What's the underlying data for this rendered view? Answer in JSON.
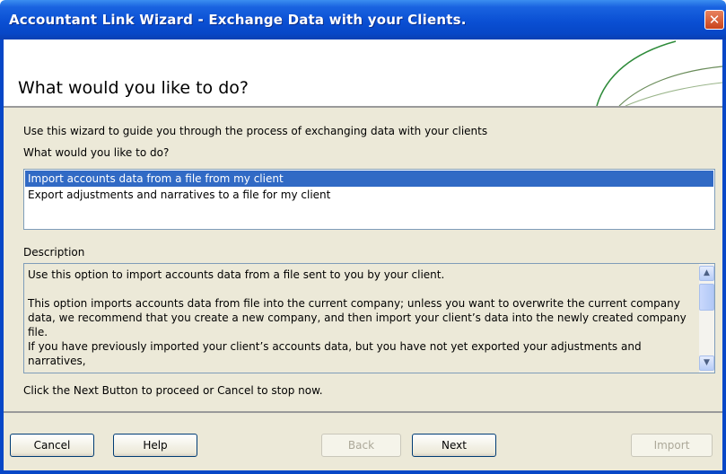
{
  "window": {
    "title": "Accountant Link Wizard - Exchange Data with your Clients.",
    "close_label": "✕"
  },
  "header": {
    "page_title": "What would you like to do?"
  },
  "main": {
    "intro_text": "Use this wizard to guide you through the process of exchanging data with your clients",
    "question": "What would you like to do?",
    "options": [
      {
        "label": "Import accounts data from a file from my client",
        "selected": true
      },
      {
        "label": "Export adjustments and narratives to a file for my client",
        "selected": false
      }
    ],
    "description_label": "Description",
    "description_paragraphs": [
      "Use this option to import accounts data from a file sent to you by your client.",
      "This option imports accounts data from file into the current company; unless you want to overwrite the current company data, we recommend that you create a new company, and then import your client’s data into the newly created company file.",
      "If you have previously imported your client’s accounts data, but you have not yet exported your adjustments and narratives,"
    ],
    "instruction": "Click the Next Button to proceed or Cancel to stop now."
  },
  "buttons": {
    "cancel": "Cancel",
    "help": "Help",
    "back": "Back",
    "next": "Next",
    "import": "Import"
  },
  "icons": {
    "close": "close-icon",
    "scroll_up": "scroll-up-arrow-icon",
    "scroll_down": "scroll-down-arrow-icon"
  },
  "colors": {
    "title_bar": "#0a4fd3",
    "selection": "#316ac5",
    "dialog_bg": "#ece9d8",
    "swoosh": "#2e8b3a"
  }
}
